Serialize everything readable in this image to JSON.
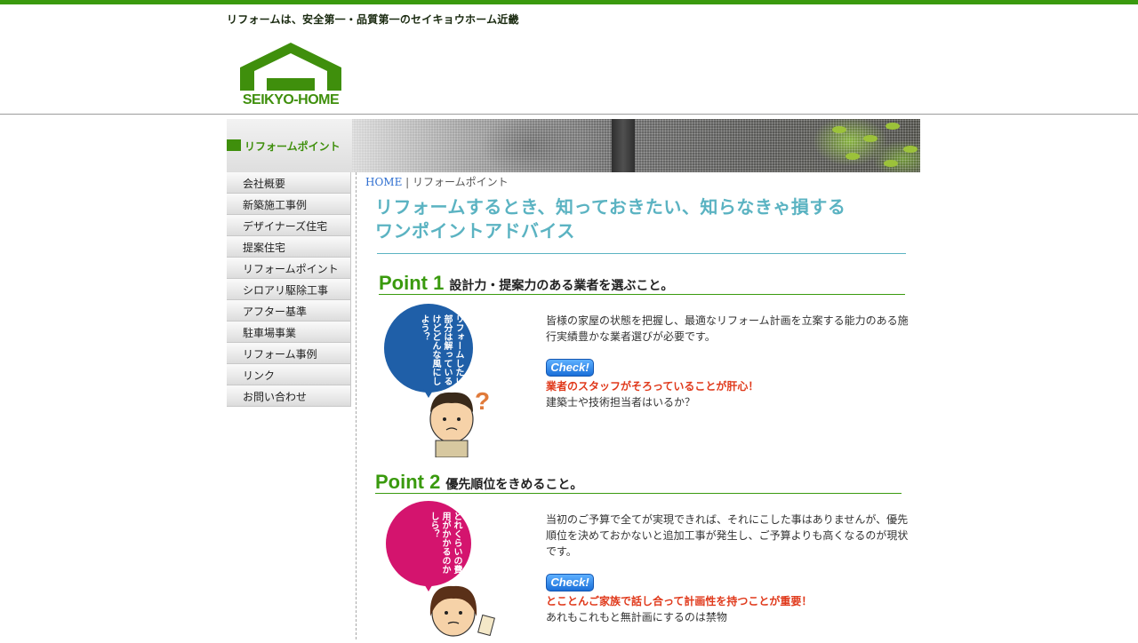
{
  "header": {
    "tagline": "リフォームは、安全第一・品質第一のセイキョウホーム近畿",
    "logo_text": "SEIKYO-HOME"
  },
  "sidebar": {
    "heading": "リフォームポイント",
    "items": [
      {
        "label": "会社概要"
      },
      {
        "label": "新築施工事例"
      },
      {
        "label": "デザイナーズ住宅"
      },
      {
        "label": "提案住宅"
      },
      {
        "label": "リフォームポイント"
      },
      {
        "label": "シロアリ駆除工事"
      },
      {
        "label": "アフター基準"
      },
      {
        "label": "駐車場事業"
      },
      {
        "label": "リフォーム事例"
      },
      {
        "label": "リンク"
      },
      {
        "label": "お問い合わせ"
      }
    ]
  },
  "breadcrumb": {
    "home": "HOME",
    "separator": " | ",
    "current": "リフォームポイント"
  },
  "intro": {
    "line1": "リフォームするとき、知っておきたい、知らなきゃ損する",
    "line2": "ワンポイントアドバイス"
  },
  "points": [
    {
      "number": "Point 1",
      "title": "設計力・提案力のある業者を選ぶこと。",
      "bubble": [
        "リフォーム",
        "したい部分は",
        "解っているけど",
        "どんな風に",
        "しよう？"
      ],
      "body": "皆様の家屋の状態を把握し、最適なリフォーム計画を立案する能力のある施行実績豊かな業者選びが必要です。",
      "check": "Check!",
      "alert": "業者のスタッフがそろっていることが肝心！",
      "note": "建築士や技術担当者はいるか？"
    },
    {
      "number": "Point 2",
      "title": "優先順位をきめること。",
      "bubble": [
        "どれくらいの",
        "費用が",
        "かかるの",
        "かしら？"
      ],
      "body": "当初のご予算で全てが実現できれば、それにこした事はありませんが、優先順位を決めておかないと追加工事が発生し、ご予算よりも高くなるのが現状です。",
      "check": "Check!",
      "alert": "とことんご家族で話し合って計画性を持つことが重要！",
      "note": "あれもこれもと無計画にするのは禁物"
    }
  ],
  "colors": {
    "brand_green": "#3a9a0e",
    "intro_teal": "#5bb3c2",
    "alert_red": "#e03a1c",
    "bubble_blue": "#1f5fa8",
    "bubble_pink": "#d4146e"
  },
  "icons": [
    "house-logo-icon",
    "question-mark-icon"
  ]
}
